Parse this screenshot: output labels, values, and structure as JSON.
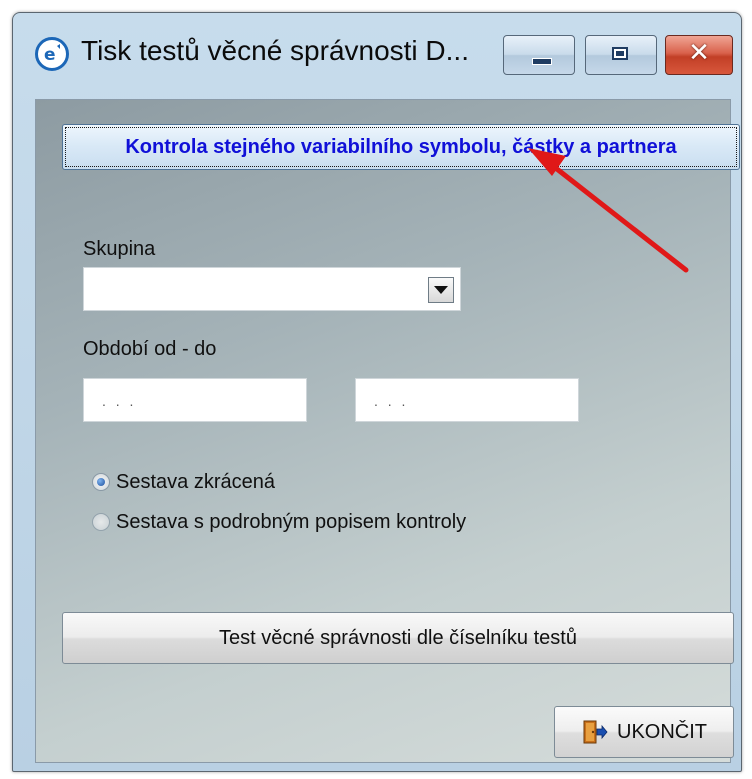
{
  "window": {
    "title": "Tisk testů věcné správnosti  D...",
    "icon": "app-logo-icon"
  },
  "titlebar_buttons": {
    "minimize_icon": "minimize-icon",
    "maximize_icon": "maximize-icon",
    "close_icon": "close-icon",
    "close_glyph": "✕"
  },
  "check_button": {
    "label": "Kontrola stejného variabilního symbolu, částky a partnera",
    "text_color": "#1010d8"
  },
  "group": {
    "label": "Skupina",
    "value": ""
  },
  "period": {
    "label": "Období od - do",
    "from_value": ". . .",
    "to_value": ". . ."
  },
  "report_options": {
    "options": [
      {
        "label": "Sestava zkrácená",
        "selected": true
      },
      {
        "label": "Sestava s podrobným popisem kontroly",
        "selected": false
      }
    ]
  },
  "test_button": {
    "label": "Test věcné správnosti dle číselníku testů"
  },
  "exit_button": {
    "label": "UKONČIT",
    "icon": "exit-door-icon"
  },
  "annotation": {
    "arrow_color": "#e01818"
  }
}
